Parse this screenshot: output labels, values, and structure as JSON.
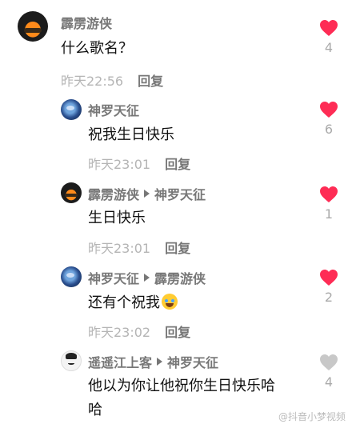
{
  "comments": [
    {
      "user": "霹雳游侠",
      "reply_to": "",
      "text": "什么歌名？",
      "time": "昨天22:56",
      "reply_label": "回复",
      "likes": "4",
      "liked": true,
      "avatar": "car-avatar"
    },
    {
      "user": "神罗天征",
      "reply_to": "",
      "text": "祝我生日快乐",
      "time": "昨天23:01",
      "reply_label": "回复",
      "likes": "6",
      "liked": true,
      "avatar": "earth-avatar"
    },
    {
      "user": "霹雳游侠",
      "reply_to": "神罗天征",
      "text": "生日快乐",
      "time": "昨天23:01",
      "reply_label": "回复",
      "likes": "1",
      "liked": true,
      "avatar": "car-avatar"
    },
    {
      "user": "神罗天征",
      "reply_to": "霹雳游侠",
      "text": "还有个祝我",
      "time": "昨天23:02",
      "reply_label": "回复",
      "likes": "2",
      "liked": true,
      "avatar": "earth-avatar",
      "emoji": "laughing-crying-emoji"
    },
    {
      "user": "遥遥江上客",
      "reply_to": "神罗天征",
      "text_line1": "他以为你让他祝你生日快乐哈",
      "text_line2": "哈",
      "likes": "4",
      "liked": false,
      "avatar": "cartoon-avatar"
    }
  ],
  "colors": {
    "heart_active": "#fe2c55",
    "heart_inactive": "#c8c8c8"
  },
  "watermark": "@抖音小梦视频"
}
